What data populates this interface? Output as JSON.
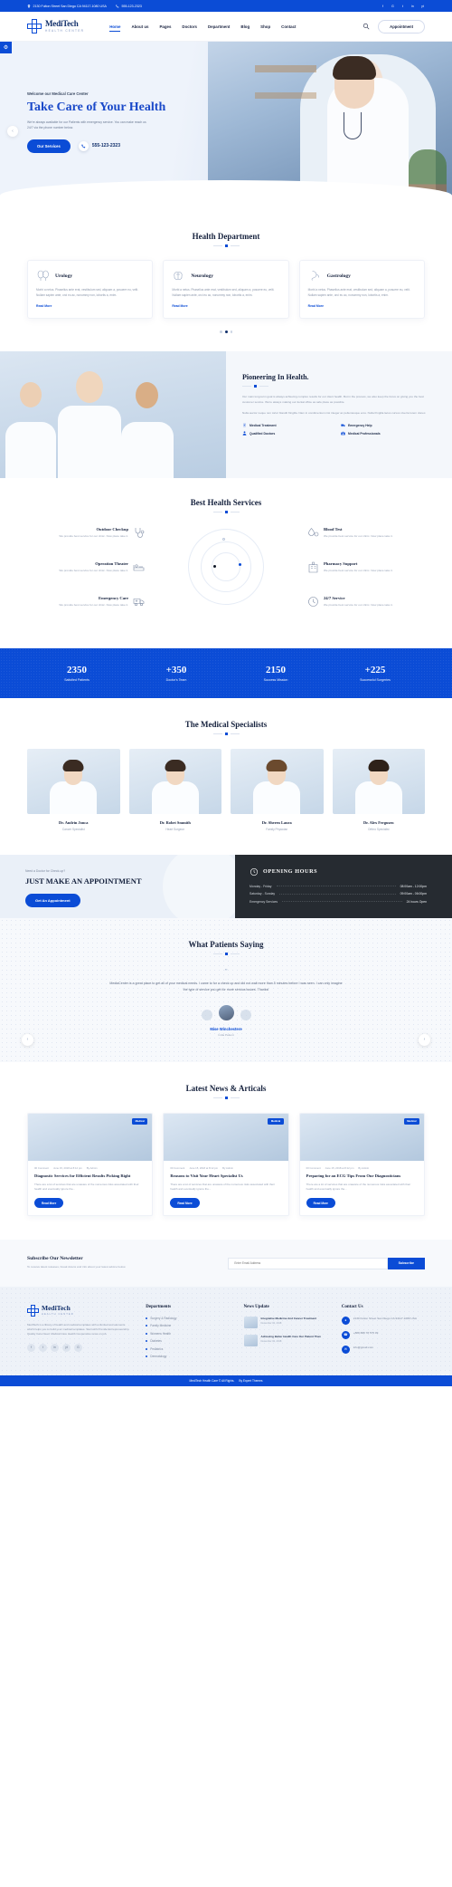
{
  "topbar": {
    "address": "2130 Fulton Street San Diego CA 94117-1080 USA",
    "phone": "555-123-2323",
    "socials": [
      "f",
      "G",
      "t",
      "in",
      "yt"
    ]
  },
  "header": {
    "brand_name": "MediTech",
    "brand_tagline": "HEALTH CENTER",
    "nav": [
      {
        "label": "Home",
        "active": true
      },
      {
        "label": "About us",
        "active": false
      },
      {
        "label": "Pages",
        "active": false
      },
      {
        "label": "Doctors",
        "active": false
      },
      {
        "label": "Department",
        "active": false
      },
      {
        "label": "Blog",
        "active": false
      },
      {
        "label": "Shop",
        "active": false
      },
      {
        "label": "Contact",
        "active": false
      }
    ],
    "appointment_label": "Appointment",
    "search_icon": "search-icon"
  },
  "hero": {
    "eyebrow": "Welcome our Medical Care Center",
    "title": "Take Care of Your Health",
    "paragraph": "We're always available for our Patients with emergency service. You can make reach us 24/7 via the phone number below.",
    "cta_label": "Our Services",
    "phone": "555-123-2323"
  },
  "department": {
    "title": "Health Department",
    "cards": [
      {
        "name": "Urology",
        "desc": "Morbi a netus. Phasellus ante erat, vestibulum sed, aliquam a, posuere eu, velit. Nullam sapien ante, orci eu ac, nonummy non, lobortis a, enim.",
        "link": "Read More"
      },
      {
        "name": "Neurology",
        "desc": "Morbi a netus. Phasellus ante erat, vestibulum sed, aliquam a, posuere eu, velit. Nullam sapien ante, orci eu ac, nonummy non, lobortis a, enim.",
        "link": "Read More"
      },
      {
        "name": "Gastrology",
        "desc": "Morbi a netus. Phasellus ante erat, vestibulum sed, aliquam a, posuere eu, velit. Nullam sapien ante, orci eu ac, nonummy non, lobortis a, enim.",
        "link": "Read More"
      }
    ],
    "dots": 3,
    "active_dot": 2
  },
  "pioneering": {
    "title": "Pioneering In Health.",
    "paragraph1": "Our main long-term goal is always achieving complex results for our client health. But in the process, we also keep the focus on giving you the best customer service. We're always making our dental office as safe place as possible.",
    "paragraph2": "Nulla auctor neque non tortor blandit fringilla. Nam in condimentum nisi integer ac pellentesque eros. Nulla fringilla lacus cursus viverra lorem donec.",
    "features": [
      {
        "label": "Medical Treatment",
        "icon": "clipboard-check-icon"
      },
      {
        "label": "Emergency Help",
        "icon": "ambulance-icon"
      },
      {
        "label": "Qualified Doctors",
        "icon": "doctor-icon"
      },
      {
        "label": "Medical Professionals",
        "icon": "briefcase-medical-icon"
      }
    ]
  },
  "services": {
    "title": "Best Health Services",
    "items": [
      {
        "name": "Outdoor Checkup",
        "desc": "We provide best service for our clinic. Now place take it.",
        "icon": "stethoscope-icon",
        "side": "left"
      },
      {
        "name": "Blood Test",
        "desc": "We provide best service for our clinic. Now place take it.",
        "icon": "blood-drop-icon",
        "side": "right"
      },
      {
        "name": "Operation Theater",
        "desc": "We provide best service for our clinic. Now place take it.",
        "icon": "hospital-bed-icon",
        "side": "left"
      },
      {
        "name": "Pharmacy Support",
        "desc": "We provide best service for our clinic. Now place take it.",
        "icon": "pharmacy-icon",
        "side": "right"
      },
      {
        "name": "Emergency Care",
        "desc": "We provide best service for our clinic. Now place take it.",
        "icon": "ambulance-icon",
        "side": "left"
      },
      {
        "name": "24/7 Service",
        "desc": "We provide best service for our clinic. Now place take it.",
        "icon": "clock-icon",
        "side": "right"
      }
    ]
  },
  "stats": [
    {
      "number": "2350",
      "label": "Satisfied Patients"
    },
    {
      "number": "+350",
      "label": "Doctor's Team"
    },
    {
      "number": "2150",
      "label": "Success Mission"
    },
    {
      "number": "+225",
      "label": "Successful Surgeries"
    }
  ],
  "specialists": {
    "title": "The Medical Specialists",
    "doctors": [
      {
        "name": "Dr. Andrin Jonca",
        "role": "Cancer Specialist"
      },
      {
        "name": "Dr. Robet Smmith",
        "role": "Heart Surgeon"
      },
      {
        "name": "Dr. Sheren Laura",
        "role": "Family Physician"
      },
      {
        "name": "Dr. Alex Fergusen",
        "role": "Orthro Specialist"
      }
    ]
  },
  "appointment": {
    "eyebrow": "Need a Doctor for Check-up?",
    "heading": "JUST MAKE AN APPOINTMENT",
    "button": "Get An Appointment",
    "hours_title": "OPENING HOURS",
    "hours_icon": "clock-icon",
    "hours": [
      {
        "day": "Monday - Friday",
        "time": "08:00am - 12:00pm"
      },
      {
        "day": "Saturday - Sunday",
        "time": "09:00am - 06:00pm"
      },
      {
        "day": "Emergency Services",
        "time": "24 hours Open"
      }
    ]
  },
  "testimonial": {
    "title": "What Patients Saying",
    "quote_mark": "”",
    "text": "MediaCenter is a great place to get all of your medical needs. I came to for a check up and did not wait more than 5 minutes before I was seen. I can only imagine the type of service you get for more serious issues. Thanks!",
    "name": "Mise Winchestere",
    "role": "India Patient",
    "prev_icon": "chevron-left-icon",
    "next_icon": "chevron-right-icon"
  },
  "news": {
    "title": "Latest News & Articals",
    "posts": [
      {
        "badge": "Medical",
        "comments": "00 Comment",
        "date": "June 15, 2018 at 8:12 pm",
        "author": "By Admin",
        "title": "Diagnostic Services for Efficient Results Picking Right",
        "desc": "There are a lot of services that are unaware of the numerous risks associated with their health and eventually ignore the...",
        "button": "Read More"
      },
      {
        "badge": "Medical",
        "comments": "00 Comment",
        "date": "June 15, 2018 at 8:12 pm",
        "author": "By Admin",
        "title": "Reasons to Visit Your Heart Specialist Us",
        "desc": "There are a lot of services that are unaware of the numerous risks associated with their health and eventually ignore the...",
        "button": "Read More"
      },
      {
        "badge": "Medical",
        "comments": "00 Comment",
        "date": "June 15, 2018 at 8:12 pm",
        "author": "By Admin",
        "title": "Preparing for an ECG Tips From Our Diagnosticians",
        "desc": "There are a lot of services that are unaware of the numerous risks associated with their health and eventually ignore the...",
        "button": "Read More"
      }
    ]
  },
  "newsletter": {
    "title": "Subscribe Our Newsletter",
    "subtitle": "To receive latest releases, break downs and info about your latest advice below.",
    "placeholder": "Enter Email Address",
    "button": "Subscribe"
  },
  "footer": {
    "brand_name": "MediTech",
    "brand_tagline": "HEALTH CENTER",
    "about": "MediTech is a library of health and medical templates with unlimited and elements which helps you to build your medical templates. Start with Provide Entrepreneurship Quality Care Need. Medical Care Health Cooperative news on job.",
    "socials": [
      "f",
      "t",
      "in",
      "yt",
      "G"
    ],
    "departments_title": "Departments",
    "departments": [
      "Surgery & Radiology",
      "Family Medicine",
      "Womens Health",
      "Diabetes",
      "Pediatrics",
      "Dermatology"
    ],
    "news_title": "News Update",
    "news": [
      {
        "title": "Integrative Medicine And Cancer Treatment",
        "date": "December 02, 2018"
      },
      {
        "title": "Achieving Better Health Care Our Patient Than",
        "date": "December 02, 2018"
      }
    ],
    "contact_title": "Contact Us",
    "contacts": [
      {
        "icon": "location-icon",
        "text": "2130 Fulton Street San Diego CA 94117-1080 USA"
      },
      {
        "icon": "phone-icon",
        "text": "+888 888 78 575 09"
      },
      {
        "icon": "mail-icon",
        "text": "info@gmail.com"
      }
    ]
  },
  "copyright": {
    "text": "MediTech Health Care © All Rights.",
    "by": "By Expert Themes"
  }
}
